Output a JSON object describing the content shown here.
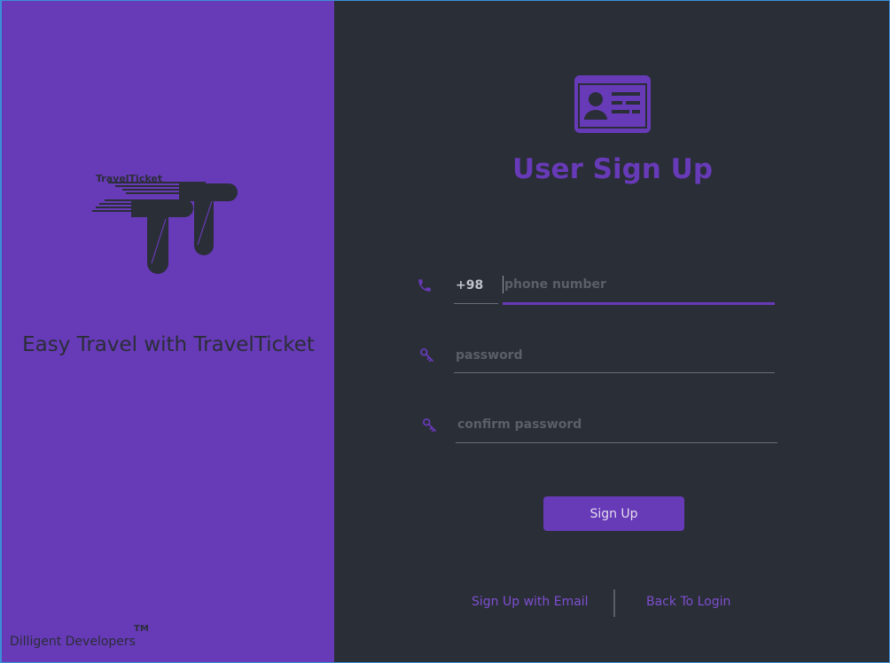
{
  "brand": {
    "logo_text": "TravelTicket",
    "tagline": "Easy Travel with TravelTicket",
    "developer": "Dilligent Developers",
    "trademark": "TM"
  },
  "form": {
    "title": "User Sign Up",
    "phone": {
      "country_code": "+98",
      "placeholder": "phone number",
      "value": ""
    },
    "password": {
      "placeholder": "password",
      "value": ""
    },
    "confirm_password": {
      "placeholder": "confirm password",
      "value": ""
    },
    "submit_label": "Sign Up"
  },
  "footer_links": {
    "email_signup": "Sign Up with Email",
    "back_to_login": "Back To Login"
  },
  "colors": {
    "accent": "#673ab7",
    "panel_dark": "#2a2e37",
    "link": "#7e4fd0",
    "placeholder": "#5b5f68"
  },
  "icons": [
    "logo-icon",
    "id-card-icon",
    "phone-icon",
    "key-icon"
  ]
}
